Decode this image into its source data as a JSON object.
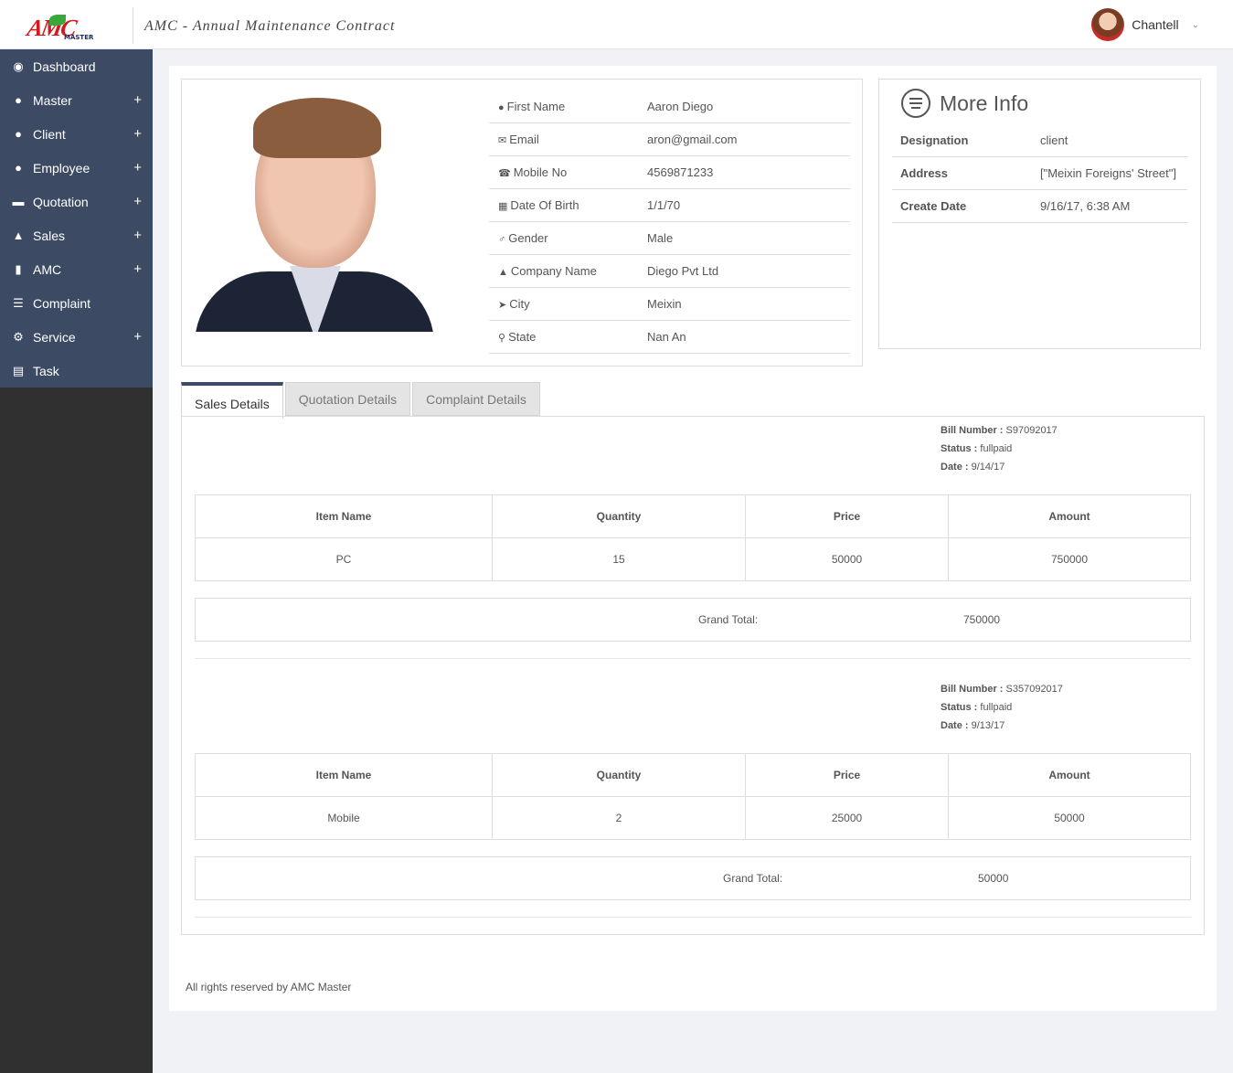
{
  "header": {
    "logo_text": "AMC",
    "logo_sub": "MASTER",
    "title": "AMC - Annual Maintenance Contract",
    "user_name": "Chantell"
  },
  "sidebar": {
    "items": [
      {
        "label": "Dashboard",
        "icon": "dashboard-icon",
        "expandable": false
      },
      {
        "label": "Master",
        "icon": "user-icon",
        "expandable": true
      },
      {
        "label": "Client",
        "icon": "users-icon",
        "expandable": true
      },
      {
        "label": "Employee",
        "icon": "user-plus-icon",
        "expandable": true
      },
      {
        "label": "Quotation",
        "icon": "quotation-icon",
        "expandable": true
      },
      {
        "label": "Sales",
        "icon": "sales-icon",
        "expandable": true
      },
      {
        "label": "AMC",
        "icon": "bookmark-icon",
        "expandable": true
      },
      {
        "label": "Complaint",
        "icon": "list-icon",
        "expandable": false
      },
      {
        "label": "Service",
        "icon": "gear-icon",
        "expandable": true
      },
      {
        "label": "Task",
        "icon": "task-icon",
        "expandable": false
      }
    ]
  },
  "profile": {
    "rows": [
      {
        "label": "First Name",
        "value": "Aaron Diego",
        "icon": "user-icon"
      },
      {
        "label": "Email",
        "value": "aron@gmail.com",
        "icon": "envelope-icon"
      },
      {
        "label": "Mobile No",
        "value": "4569871233",
        "icon": "phone-icon"
      },
      {
        "label": "Date Of Birth",
        "value": "1/1/70",
        "icon": "calendar-icon"
      },
      {
        "label": "Gender",
        "value": "Male",
        "icon": "male-icon"
      },
      {
        "label": "Company Name",
        "value": "Diego Pvt Ltd",
        "icon": "graduation-cap-icon"
      },
      {
        "label": "City",
        "value": "Meixin",
        "icon": "location-arrow-icon"
      },
      {
        "label": "State",
        "value": "Nan An",
        "icon": "map-marker-icon"
      }
    ]
  },
  "more_info": {
    "title": "More Info",
    "rows": [
      {
        "label": "Designation",
        "value": "client"
      },
      {
        "label": "Address",
        "value": "[\"Meixin Foreigns' Street\"]"
      },
      {
        "label": "Create Date",
        "value": "9/16/17, 6:38 AM"
      }
    ]
  },
  "tabs": [
    {
      "label": "Sales Details",
      "active": true
    },
    {
      "label": "Quotation Details",
      "active": false
    },
    {
      "label": "Complaint Details",
      "active": false
    }
  ],
  "sales": {
    "columns": [
      "Item Name",
      "Quantity",
      "Price",
      "Amount"
    ],
    "bill_number_label": "Bill Number :",
    "status_label": "Status :",
    "date_label": "Date :",
    "grand_total_label": "Grand Total:",
    "bills": [
      {
        "bill_number": "S97092017",
        "status": "fullpaid",
        "date": "9/14/17",
        "items": [
          [
            "PC",
            "15",
            "50000",
            "750000"
          ]
        ],
        "grand_total": "750000"
      },
      {
        "bill_number": "S357092017",
        "status": "fullpaid",
        "date": "9/13/17",
        "items": [
          [
            "Mobile",
            "2",
            "25000",
            "50000"
          ]
        ],
        "grand_total": "50000"
      }
    ]
  },
  "footer": {
    "text": "All rights reserved by AMC Master"
  }
}
